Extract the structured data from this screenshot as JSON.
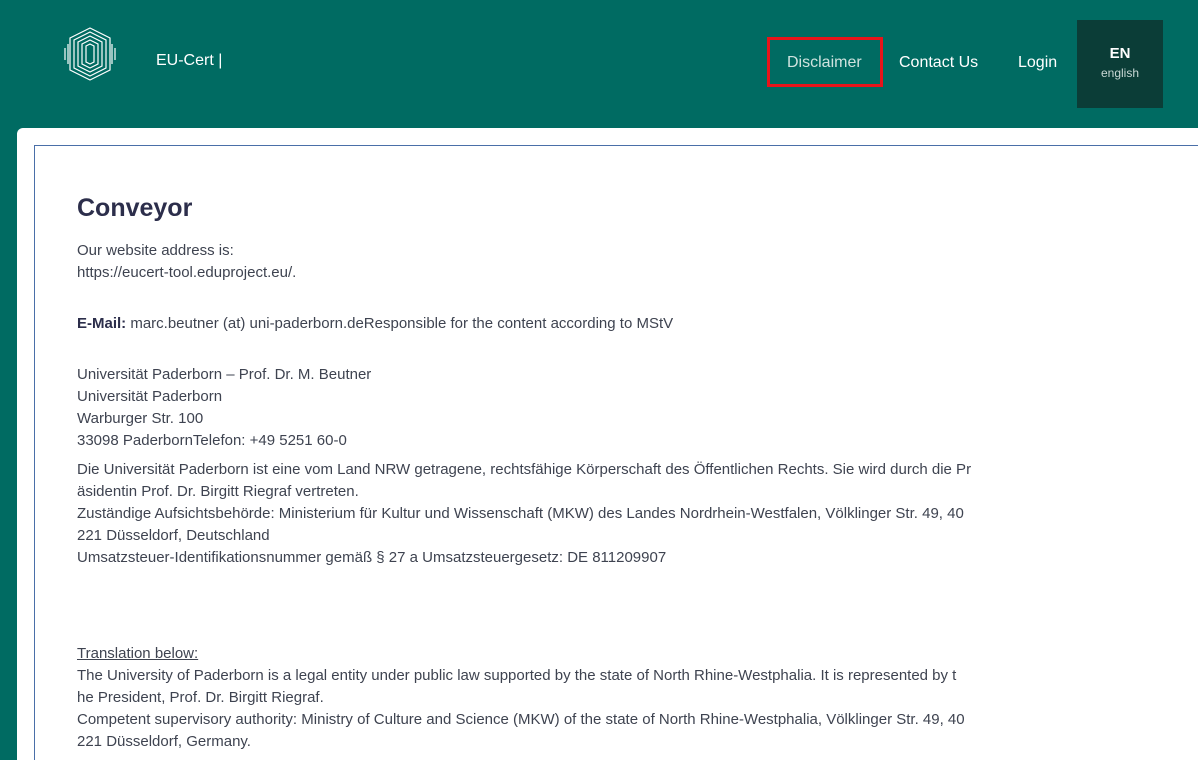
{
  "header": {
    "brand": "EU-Cert |",
    "nav": {
      "disclaimer": "Disclaimer",
      "contact": "Contact Us",
      "login": "Login"
    },
    "language": {
      "code": "EN",
      "name": "english"
    }
  },
  "colors": {
    "header_bg": "#006b62",
    "lang_bg": "#0b3d37",
    "highlight": "#e8141a",
    "title": "#2c2e4b",
    "text": "#3e4350"
  },
  "content": {
    "title": "Conveyor",
    "address_label": "Our website address is:",
    "address_url": "https://eucert-tool.eduproject.eu/.",
    "email_label": "E-Mail:",
    "email_text": " marc.beutner (at) uni-paderborn.deResponsible for the content according to MStV",
    "postal": [
      "Universität Paderborn – Prof. Dr. M. Beutner",
      "Universität Paderborn",
      "Warburger Str. 100",
      "33098 PaderbornTelefon: +49 5251 60-0"
    ],
    "german": [
      "Die Universität Paderborn ist eine vom Land NRW getragene, rechtsfähige Körperschaft des Öffentlichen Rechts. Sie wird durch die Pr",
      "äsidentin Prof. Dr. Birgitt Riegraf vertreten.",
      "Zuständige Aufsichtsbehörde: Ministerium für Kultur und Wissenschaft (MKW) des Landes Nordrhein-Westfalen, Völklinger Str. 49, 40",
      "221 Düsseldorf, Deutschland",
      "Umsatzsteuer-Identifikationsnummer gemäß § 27 a Umsatzsteuergesetz: DE 811209907"
    ],
    "translation_label": "Translation below:",
    "english": [
      "The University of Paderborn is a legal entity under public law supported by the state of North Rhine-Westphalia. It is represented by t",
      "he President, Prof. Dr. Birgitt Riegraf.",
      "Competent supervisory authority: Ministry of Culture and Science (MKW) of the state of North Rhine-Westphalia, Völklinger Str. 49, 40",
      "221 Düsseldorf, Germany."
    ]
  }
}
